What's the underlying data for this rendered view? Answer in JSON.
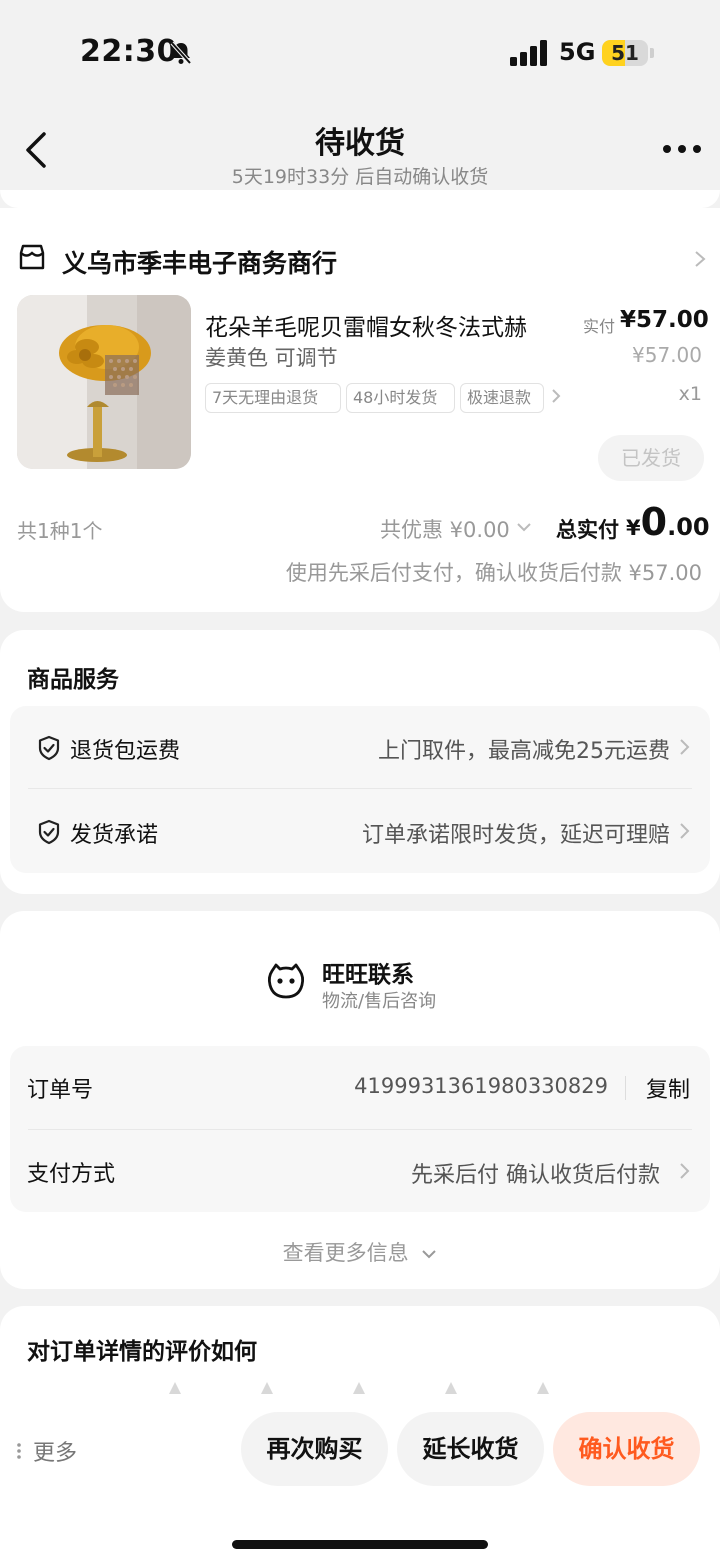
{
  "status_bar": {
    "time": "22:30",
    "network": "5G",
    "battery": "51",
    "battery_level": 0.51
  },
  "header": {
    "title": "待收货",
    "subtitle": "5天19时33分 后自动确认收货"
  },
  "shop": {
    "name": "义乌市季丰电子商务商行",
    "product": {
      "title": "花朵羊毛呢贝雷帽女秋冬法式赫",
      "sku": "姜黄色 可调节",
      "tags": [
        "7天无理由退货",
        "48小时发货",
        "极速退款"
      ],
      "price_label": "实付",
      "price_actual": "¥57.00",
      "price_original": "¥57.00",
      "quantity": "x1",
      "status_button": "已发货"
    },
    "summary": {
      "count": "共1种1个",
      "discount": "共优惠 ¥0.00",
      "total_label": "总实付",
      "total_currency": "¥",
      "total_int": "0",
      "total_dec": ".00",
      "pay_note": "使用先采后付支付，确认收货后付款 ¥57.00"
    }
  },
  "services": {
    "title": "商品服务",
    "items": [
      {
        "label": "退货包运费",
        "desc": "上门取件，最高减免25元运费"
      },
      {
        "label": "发货承诺",
        "desc": "订单承诺限时发货，延迟可理赔"
      }
    ]
  },
  "contact": {
    "title": "旺旺联系",
    "subtitle": "物流/售后咨询"
  },
  "order_info": {
    "order_no_label": "订单号",
    "order_no": "4199931361980330829",
    "copy_label": "复制",
    "pay_method_label": "支付方式",
    "pay_method": "先采后付 确认收货后付款",
    "see_more": "查看更多信息"
  },
  "rating": {
    "title": "对订单详情的评价如何"
  },
  "bottom_bar": {
    "more": "更多",
    "buy_again": "再次购买",
    "extend": "延长收货",
    "confirm": "确认收货"
  },
  "colors": {
    "accent": "#ff5a1f",
    "accent_bg": "#ffe8e0",
    "battery": "#ffd21f"
  }
}
